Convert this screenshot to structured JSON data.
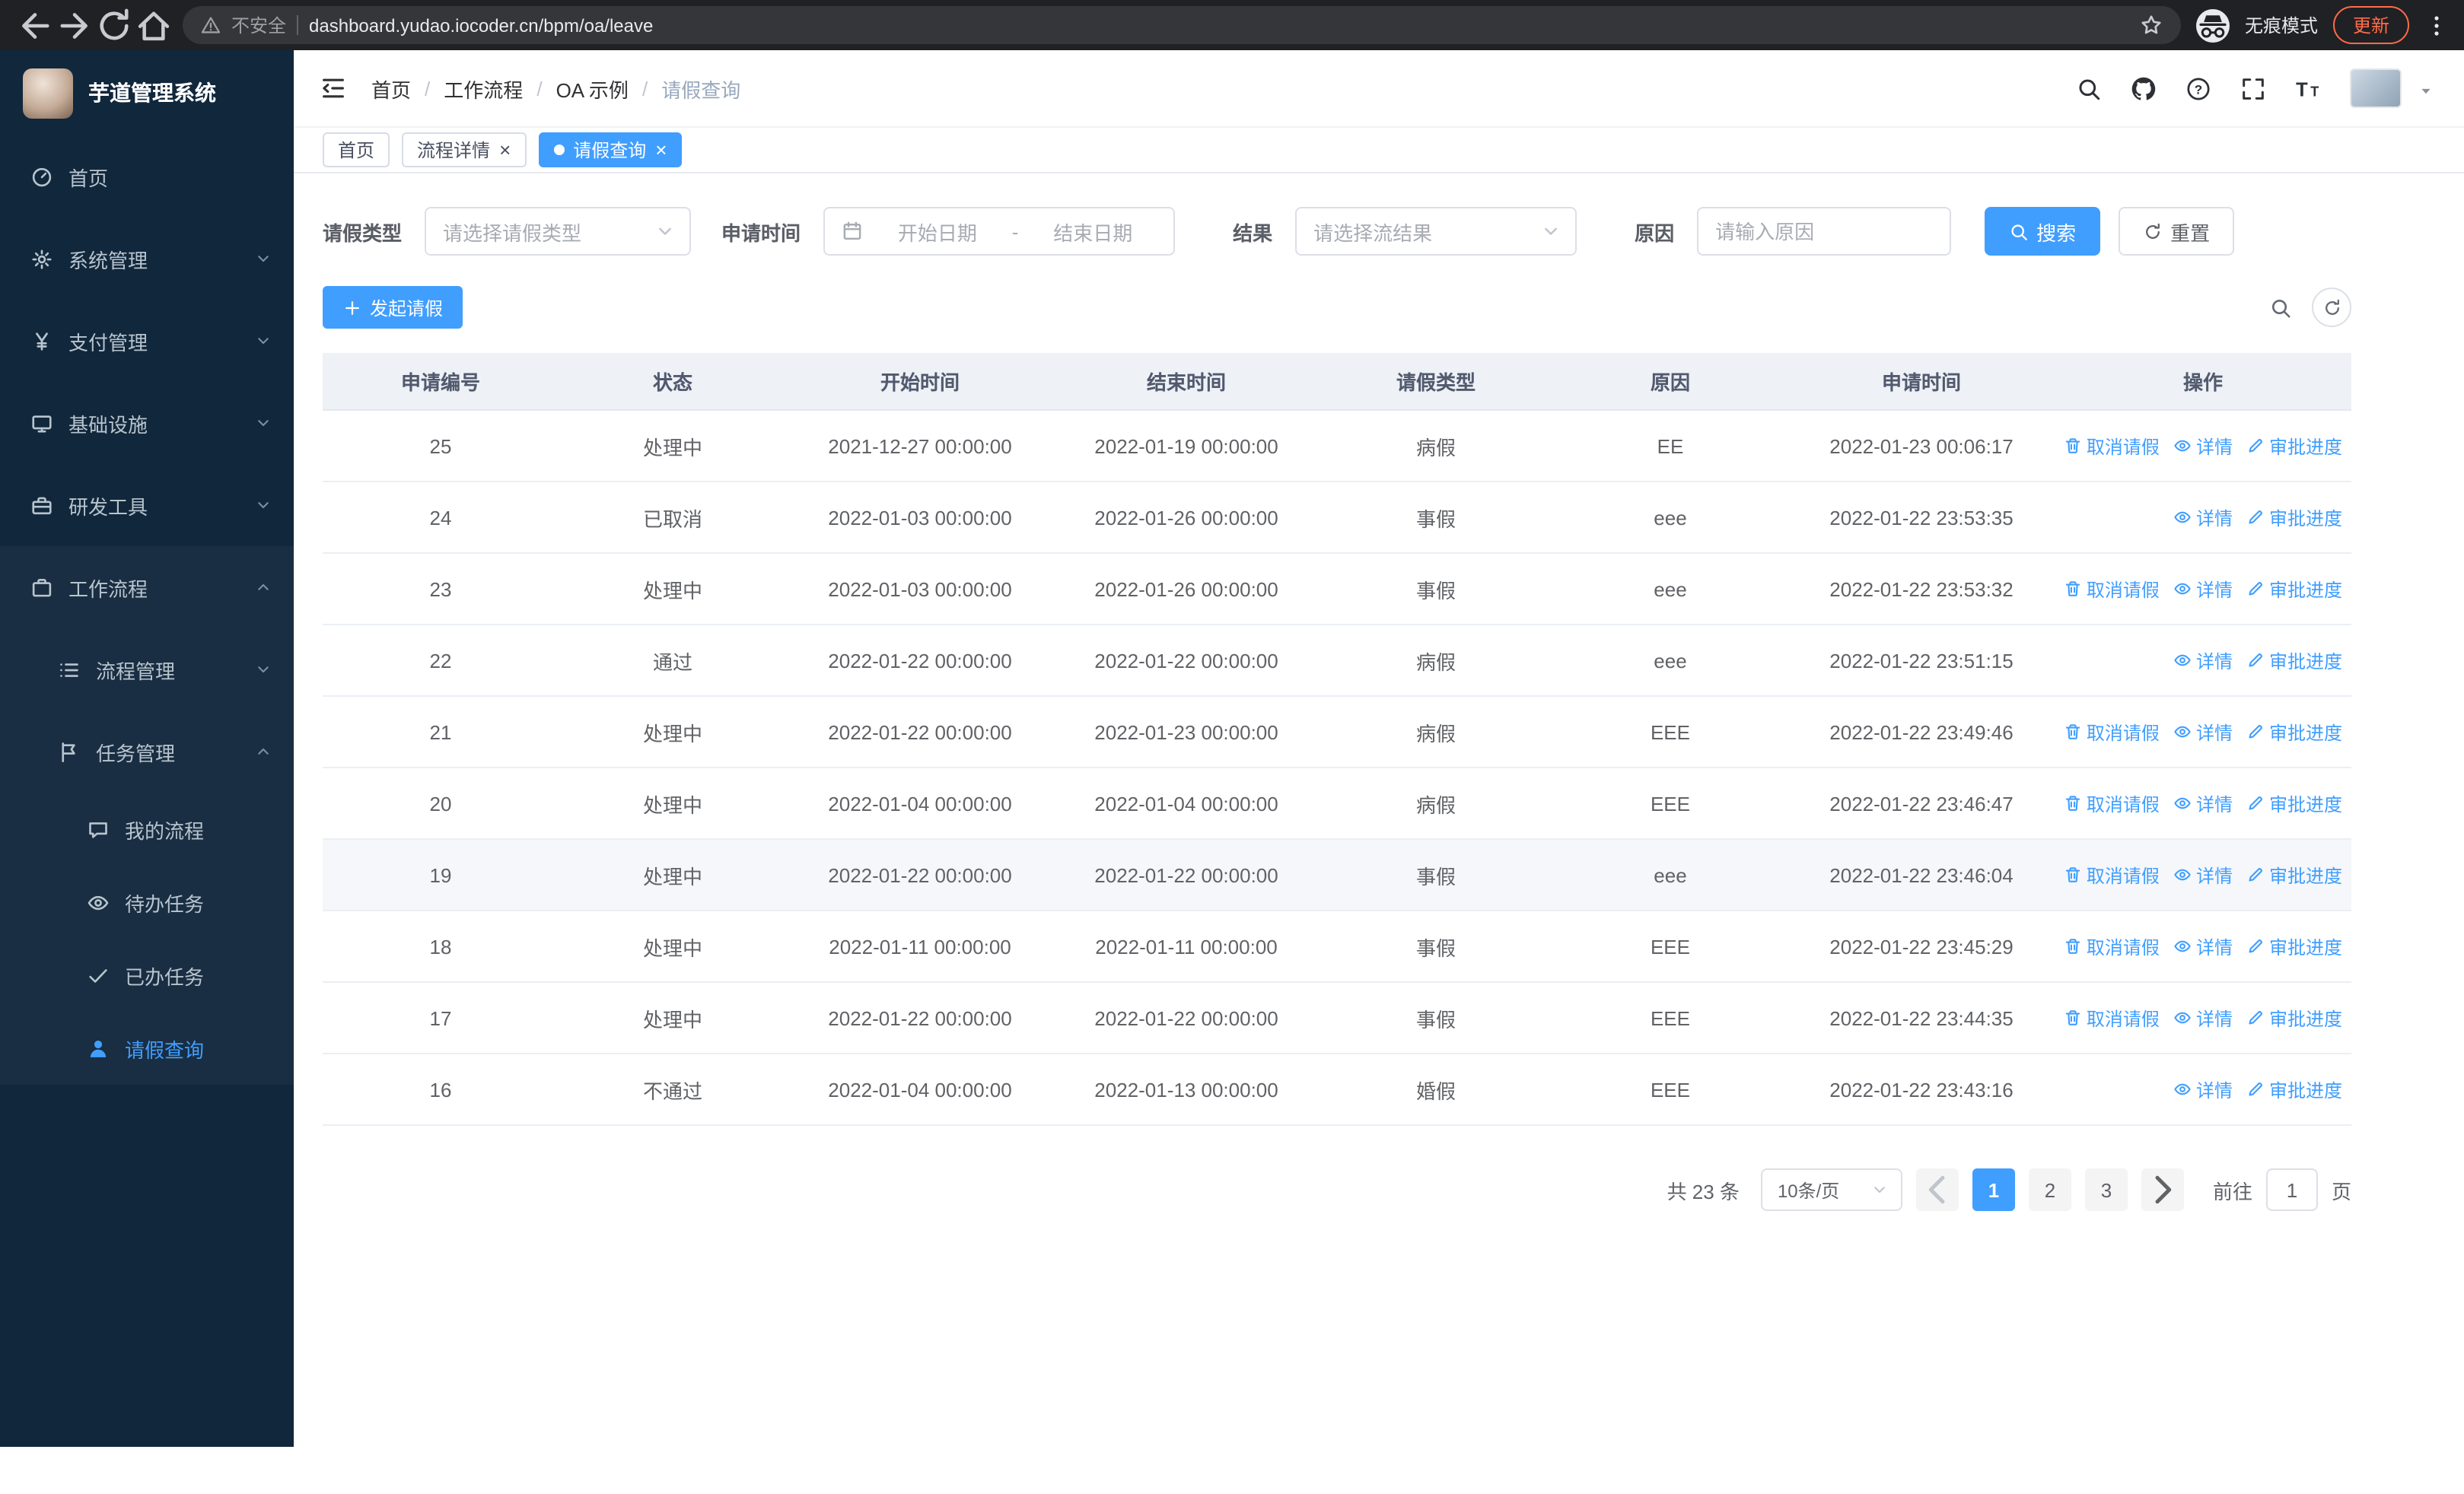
{
  "browser": {
    "security_warning": "不安全",
    "url": "dashboard.yudao.iocoder.cn/bpm/oa/leave",
    "incognito_label": "无痕模式",
    "update_label": "更新"
  },
  "sidebar": {
    "logo_title": "芋道管理系统",
    "items": [
      {
        "key": "home",
        "label": "首页",
        "icon": "dashboard-icon",
        "level": 1
      },
      {
        "key": "system-mgmt",
        "label": "系统管理",
        "icon": "gear-icon",
        "level": 1,
        "caret": "down"
      },
      {
        "key": "payment-mgmt",
        "label": "支付管理",
        "icon": "yen-icon",
        "level": 1,
        "caret": "down"
      },
      {
        "key": "infrastructure",
        "label": "基础设施",
        "icon": "monitor-icon",
        "level": 1,
        "caret": "down"
      },
      {
        "key": "dev-tools",
        "label": "研发工具",
        "icon": "toolbox-icon",
        "level": 1,
        "caret": "down"
      },
      {
        "key": "workflow",
        "label": "工作流程",
        "icon": "briefcase-icon",
        "level": 1,
        "caret": "up",
        "section": true
      },
      {
        "key": "process-mgmt",
        "label": "流程管理",
        "icon": "list-icon",
        "level": 2,
        "caret": "down",
        "section": true
      },
      {
        "key": "task-mgmt",
        "label": "任务管理",
        "icon": "flag-icon",
        "level": 2,
        "caret": "up",
        "section": true
      },
      {
        "key": "my-process",
        "label": "我的流程",
        "icon": "chat-icon",
        "level": 3,
        "section": true
      },
      {
        "key": "todo-tasks",
        "label": "待办任务",
        "icon": "eye-icon",
        "level": 3,
        "section": true
      },
      {
        "key": "done-tasks",
        "label": "已办任务",
        "icon": "check-icon",
        "level": 3,
        "section": true
      },
      {
        "key": "leave-query",
        "label": "请假查询",
        "icon": "user-icon",
        "level": 3,
        "section": true,
        "active": true
      }
    ]
  },
  "header": {
    "breadcrumb": [
      "首页",
      "工作流程",
      "OA 示例",
      "请假查询"
    ]
  },
  "tabs": [
    {
      "key": "home",
      "label": "首页"
    },
    {
      "key": "process-detail",
      "label": "流程详情",
      "closable": true
    },
    {
      "key": "leave-query",
      "label": "请假查询",
      "closable": true,
      "active": true
    }
  ],
  "filters": {
    "leave_type_label": "请假类型",
    "leave_type_placeholder": "请选择请假类型",
    "apply_time_label": "申请时间",
    "start_date_placeholder": "开始日期",
    "range_separator": "-",
    "end_date_placeholder": "结束日期",
    "result_label": "结果",
    "result_placeholder": "请选择流结果",
    "reason_label": "原因",
    "reason_placeholder": "请输入原因",
    "search_label": "搜索",
    "reset_label": "重置"
  },
  "toolbar": {
    "create_label": "发起请假"
  },
  "table": {
    "columns": [
      "申请编号",
      "状态",
      "开始时间",
      "结束时间",
      "请假类型",
      "原因",
      "申请时间",
      "操作"
    ],
    "actions": {
      "cancel": "取消请假",
      "detail": "详情",
      "progress": "审批进度"
    },
    "rows": [
      {
        "id": "25",
        "status": "处理中",
        "start": "2021-12-27 00:00:00",
        "end": "2022-01-19 00:00:00",
        "type": "病假",
        "reason": "EE",
        "applied": "2022-01-23 00:06:17",
        "cancellable": true
      },
      {
        "id": "24",
        "status": "已取消",
        "start": "2022-01-03 00:00:00",
        "end": "2022-01-26 00:00:00",
        "type": "事假",
        "reason": "eee",
        "applied": "2022-01-22 23:53:35",
        "cancellable": false
      },
      {
        "id": "23",
        "status": "处理中",
        "start": "2022-01-03 00:00:00",
        "end": "2022-01-26 00:00:00",
        "type": "事假",
        "reason": "eee",
        "applied": "2022-01-22 23:53:32",
        "cancellable": true
      },
      {
        "id": "22",
        "status": "通过",
        "start": "2022-01-22 00:00:00",
        "end": "2022-01-22 00:00:00",
        "type": "病假",
        "reason": "eee",
        "applied": "2022-01-22 23:51:15",
        "cancellable": false
      },
      {
        "id": "21",
        "status": "处理中",
        "start": "2022-01-22 00:00:00",
        "end": "2022-01-23 00:00:00",
        "type": "病假",
        "reason": "EEE",
        "applied": "2022-01-22 23:49:46",
        "cancellable": true
      },
      {
        "id": "20",
        "status": "处理中",
        "start": "2022-01-04 00:00:00",
        "end": "2022-01-04 00:00:00",
        "type": "病假",
        "reason": "EEE",
        "applied": "2022-01-22 23:46:47",
        "cancellable": true
      },
      {
        "id": "19",
        "status": "处理中",
        "start": "2022-01-22 00:00:00",
        "end": "2022-01-22 00:00:00",
        "type": "事假",
        "reason": "eee",
        "applied": "2022-01-22 23:46:04",
        "cancellable": true,
        "highlighted": true
      },
      {
        "id": "18",
        "status": "处理中",
        "start": "2022-01-11 00:00:00",
        "end": "2022-01-11 00:00:00",
        "type": "事假",
        "reason": "EEE",
        "applied": "2022-01-22 23:45:29",
        "cancellable": true
      },
      {
        "id": "17",
        "status": "处理中",
        "start": "2022-01-22 00:00:00",
        "end": "2022-01-22 00:00:00",
        "type": "事假",
        "reason": "EEE",
        "applied": "2022-01-22 23:44:35",
        "cancellable": true
      },
      {
        "id": "16",
        "status": "不通过",
        "start": "2022-01-04 00:00:00",
        "end": "2022-01-13 00:00:00",
        "type": "婚假",
        "reason": "EEE",
        "applied": "2022-01-22 23:43:16",
        "cancellable": false
      }
    ]
  },
  "pagination": {
    "total_label": "共 23 条",
    "page_size_value": "10条/页",
    "pages": [
      "1",
      "2",
      "3"
    ],
    "active_page": "1",
    "goto_label": "前往",
    "goto_value": "1",
    "page_unit_label": "页"
  },
  "colors": {
    "accent": "#409eff",
    "sidebar_bg": "#11273c",
    "chrome_bg": "#202124",
    "update_pill": "#ff6c47"
  }
}
